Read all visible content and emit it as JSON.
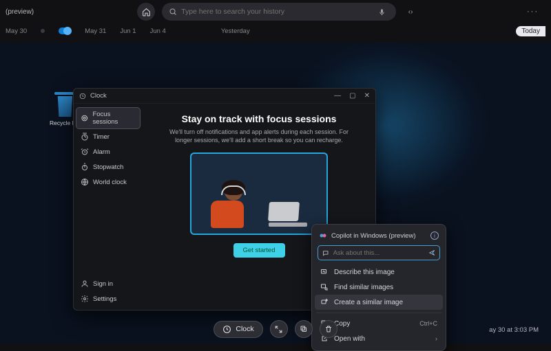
{
  "header": {
    "preview_label": "(preview)",
    "search_placeholder": "Type here to search your history",
    "more_label": "···"
  },
  "timeline": {
    "dates": [
      "May 30",
      "May 31",
      "Jun 1",
      "Jun 4",
      "Yesterday"
    ],
    "today_label": "Today"
  },
  "desktop": {
    "recycle_bin_label": "Recycle Bin"
  },
  "clock_window": {
    "title": "Clock",
    "sidebar_items": [
      {
        "label": "Focus sessions",
        "icon": "target-icon",
        "selected": true
      },
      {
        "label": "Timer",
        "icon": "timer-icon"
      },
      {
        "label": "Alarm",
        "icon": "alarm-icon"
      },
      {
        "label": "Stopwatch",
        "icon": "stopwatch-icon"
      },
      {
        "label": "World clock",
        "icon": "globe-icon"
      }
    ],
    "footer_items": [
      {
        "label": "Sign in",
        "icon": "person-icon"
      },
      {
        "label": "Settings",
        "icon": "gear-icon"
      }
    ],
    "heading": "Stay on track with focus sessions",
    "subtext": "We'll turn off notifications and app alerts during each session. For longer sessions, we'll add a short break so you can recharge.",
    "cta_label": "Get started"
  },
  "context_menu": {
    "title": "Copilot in Windows (preview)",
    "ask_placeholder": "Ask about this...",
    "items_top": [
      {
        "label": "Describe this image",
        "icon": "describe-icon"
      },
      {
        "label": "Find similar images",
        "icon": "search-image-icon"
      },
      {
        "label": "Create a similar image",
        "icon": "sparkle-icon",
        "hover": true
      }
    ],
    "items_bottom": [
      {
        "label": "Copy",
        "icon": "copy-icon",
        "shortcut": "Ctrl+C"
      },
      {
        "label": "Open with",
        "icon": "open-icon",
        "submenu": true
      }
    ]
  },
  "bottom_bar": {
    "app_label": "Clock"
  },
  "caption": "ay 30 at 3:03 PM"
}
